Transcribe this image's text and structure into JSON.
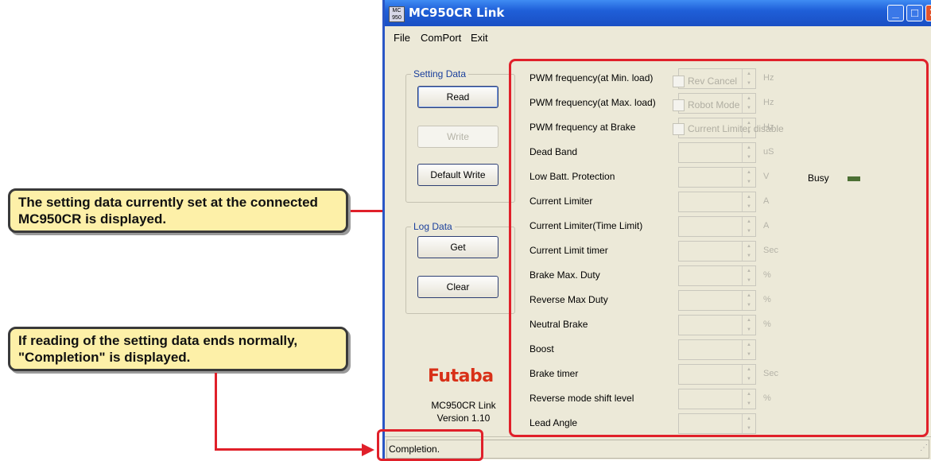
{
  "callouts": {
    "setting_data": "The setting data currently set at the connected MC950CR is displayed.",
    "completion": "If reading of the setting data ends normally, \"Completion\" is displayed."
  },
  "window": {
    "title": "MC950CR Link",
    "app_icon": "MC 950",
    "buttons": {
      "minimize": "_",
      "maximize": "□",
      "close": "✕"
    }
  },
  "menu": {
    "file": "File",
    "comport": "ComPort",
    "exit": "Exit"
  },
  "setting_group": {
    "label": "Setting Data",
    "read": "Read",
    "write": "Write",
    "default_write": "Default Write"
  },
  "log_group": {
    "label": "Log Data",
    "get": "Get",
    "clear": "Clear"
  },
  "branding": {
    "logo": "Futaba",
    "app_name": "MC950CR Link",
    "version": "Version 1.10"
  },
  "settings": [
    {
      "label": "PWM frequency(at Min. load)",
      "unit": "Hz"
    },
    {
      "label": "PWM frequency(at Max. load)",
      "unit": "Hz"
    },
    {
      "label": "PWM frequency at Brake",
      "unit": "Hz"
    },
    {
      "label": "Dead Band",
      "unit": "uS"
    },
    {
      "label": "Low Batt. Protection",
      "unit": "V"
    },
    {
      "label": "Current Limiter",
      "unit": "A"
    },
    {
      "label": "Current Limiter(Time Limit)",
      "unit": "A"
    },
    {
      "label": "Current Limit timer",
      "unit": "Sec"
    },
    {
      "label": "Brake Max. Duty",
      "unit": "%"
    },
    {
      "label": "Reverse Max Duty",
      "unit": "%"
    },
    {
      "label": "Neutral Brake",
      "unit": "%"
    },
    {
      "label": "Boost",
      "unit": ""
    },
    {
      "label": "Brake timer",
      "unit": "Sec"
    },
    {
      "label": "Reverse mode shift level",
      "unit": "%"
    },
    {
      "label": "Lead Angle",
      "unit": ""
    }
  ],
  "checkboxes": {
    "rev_cancel": "Rev Cancel",
    "robot_mode": "Robot Mode",
    "current_limiter_disable": "Current Limiter disable"
  },
  "busy": "Busy",
  "status": "Completion.",
  "colors": {
    "highlight": "#e0202a",
    "callout_bg": "#fdf0a8",
    "titlebar": "#1f5fd8",
    "logo": "#d83018"
  }
}
